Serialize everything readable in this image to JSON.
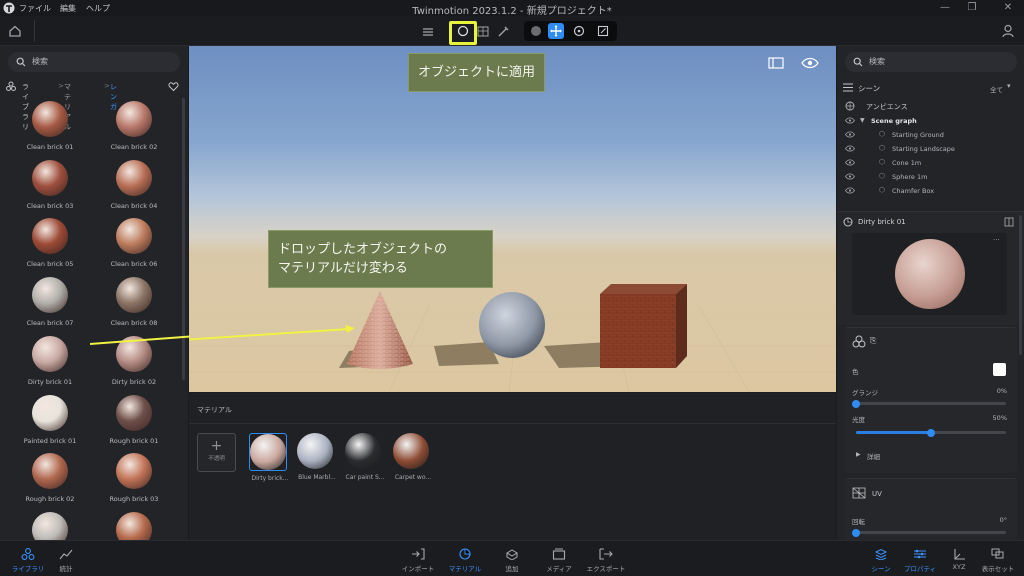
{
  "window": {
    "title": "Twinmotion 2023.1.2 - 新規プロジェクト*",
    "menu": [
      "ファイル",
      "編集",
      "ヘルプ"
    ]
  },
  "left_panel": {
    "search_placeholder": "検索",
    "breadcrumb": {
      "root": "ライブラリ",
      "sep1": ">",
      "mid": "マテリアル",
      "sep2": ">",
      "current": "レンガ"
    },
    "materials": [
      {
        "label": "Clean brick 01",
        "color": "#a55a44"
      },
      {
        "label": "Clean brick 02",
        "color": "#b8786a"
      },
      {
        "label": "Clean brick 03",
        "color": "#9e4f3e"
      },
      {
        "label": "Clean brick 04",
        "color": "#b86f56"
      },
      {
        "label": "Clean brick 05",
        "color": "#9c4a36"
      },
      {
        "label": "Clean brick 06",
        "color": "#bd7c5e"
      },
      {
        "label": "Clean brick 07",
        "color": "#b2b0ab"
      },
      {
        "label": "Clean brick 08",
        "color": "#8b7566"
      },
      {
        "label": "Dirty brick 01",
        "color": "#c9aaa5"
      },
      {
        "label": "Dirty brick 02",
        "color": "#b58d86"
      },
      {
        "label": "Painted brick 01",
        "color": "#e7e4dc"
      },
      {
        "label": "Rough brick 01",
        "color": "#6e4f4a"
      },
      {
        "label": "Rough brick 02",
        "color": "#b0684f"
      },
      {
        "label": "Rough brick 03",
        "color": "#c27458"
      },
      {
        "label": "",
        "color": "#bfbcb8"
      },
      {
        "label": "",
        "color": "#b56a4d"
      }
    ]
  },
  "viewport": {
    "callout_top": "オブジェクトに適用",
    "callout_mid_line1": "ドロップしたオブジェクトの",
    "callout_mid_line2": "マテリアルだけ変わる"
  },
  "material_bar": {
    "header": "マテリアル",
    "add_label": "不透明",
    "slots": [
      {
        "label": "Dirty brick...",
        "color": "#c9a79e"
      },
      {
        "label": "Blue Marbl...",
        "color": "#aab2c2"
      },
      {
        "label": "Car paint S...",
        "color": "#2b2c2f"
      },
      {
        "label": "Carpet wo...",
        "color": "#8e4c35"
      }
    ]
  },
  "right_panel": {
    "search_placeholder": "検索",
    "scene_title": "シーン",
    "filter": "全て",
    "ambience": "アンビエンス",
    "scene_graph": "Scene graph",
    "tree": [
      "Starting Ground",
      "Starting Landscape",
      "Cone 1m",
      "Sphere 1m",
      "Chamfer Box"
    ],
    "selected_material": "Dirty brick 01",
    "color_label": "色",
    "glossiness_label": "グランジ",
    "glossiness_value": "0%",
    "glossiness_fraction": 0.0,
    "shine_label": "光度",
    "shine_value": "50%",
    "shine_fraction": 0.5,
    "details": "詳細",
    "uv_title": "UV",
    "rotation_label": "回転",
    "rotation_value": "0°",
    "rotation_fraction": 0.0
  },
  "bottom_bar": {
    "left": [
      {
        "label": "ライブラリ",
        "icon": "library-icon",
        "active": true
      },
      {
        "label": "統計",
        "icon": "stats-icon",
        "active": false
      }
    ],
    "center": [
      {
        "label": "インポート",
        "icon": "import-icon",
        "active": false
      },
      {
        "label": "マテリアル",
        "icon": "material-icon",
        "active": true
      },
      {
        "label": "追加",
        "icon": "add-icon",
        "active": false
      },
      {
        "label": "メディア",
        "icon": "media-icon",
        "active": false
      },
      {
        "label": "エクスポート",
        "icon": "export-icon",
        "active": false
      }
    ],
    "right": [
      {
        "label": "シーン",
        "icon": "scene-icon",
        "active": true
      },
      {
        "label": "プロパティ",
        "icon": "properties-icon",
        "active": true
      },
      {
        "label": "XYZ",
        "icon": "xyz-icon",
        "active": false
      },
      {
        "label": "表示セット",
        "icon": "display-set-icon",
        "active": false
      }
    ]
  },
  "colors": {
    "accent": "#2f8cf5",
    "highlight": "#e8f43a",
    "callout_bg": "#6b7b4e"
  }
}
